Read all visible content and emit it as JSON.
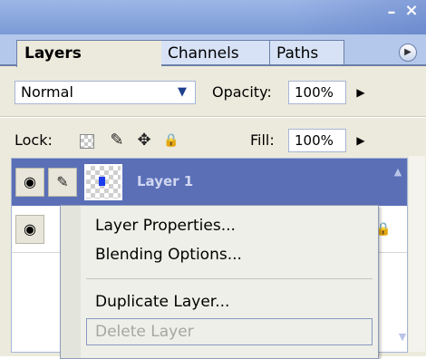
{
  "window": {
    "minimize_glyph": "–",
    "close_glyph": "×"
  },
  "tabs": [
    {
      "label": "Layers",
      "active": true
    },
    {
      "label": "Channels",
      "active": false
    },
    {
      "label": "Paths",
      "active": false
    }
  ],
  "panel_menu_icon": "flyout-arrow-icon",
  "blend": {
    "mode": "Normal",
    "opacity_label": "Opacity:",
    "opacity_value": "100%"
  },
  "lock": {
    "label": "Lock:",
    "icons": [
      "transparency-lock-icon",
      "brush-lock-icon",
      "move-lock-icon",
      "padlock-icon"
    ],
    "fill_label": "Fill:",
    "fill_value": "100%"
  },
  "layers": [
    {
      "name": "Layer 1",
      "selected": true,
      "visible": true
    }
  ],
  "context_menu": {
    "items": [
      {
        "label": "Layer Properties...",
        "enabled": true
      },
      {
        "label": "Blending Options...",
        "enabled": true
      },
      {
        "label": "Duplicate Layer...",
        "enabled": true
      },
      {
        "label": "Delete Layer",
        "enabled": false
      }
    ]
  },
  "colors": {
    "selected_row": "#5b6fb7",
    "title_bar": "#8aa6de",
    "panel_bg": "#eceadc",
    "disabled_text": "#a6a8a0"
  }
}
